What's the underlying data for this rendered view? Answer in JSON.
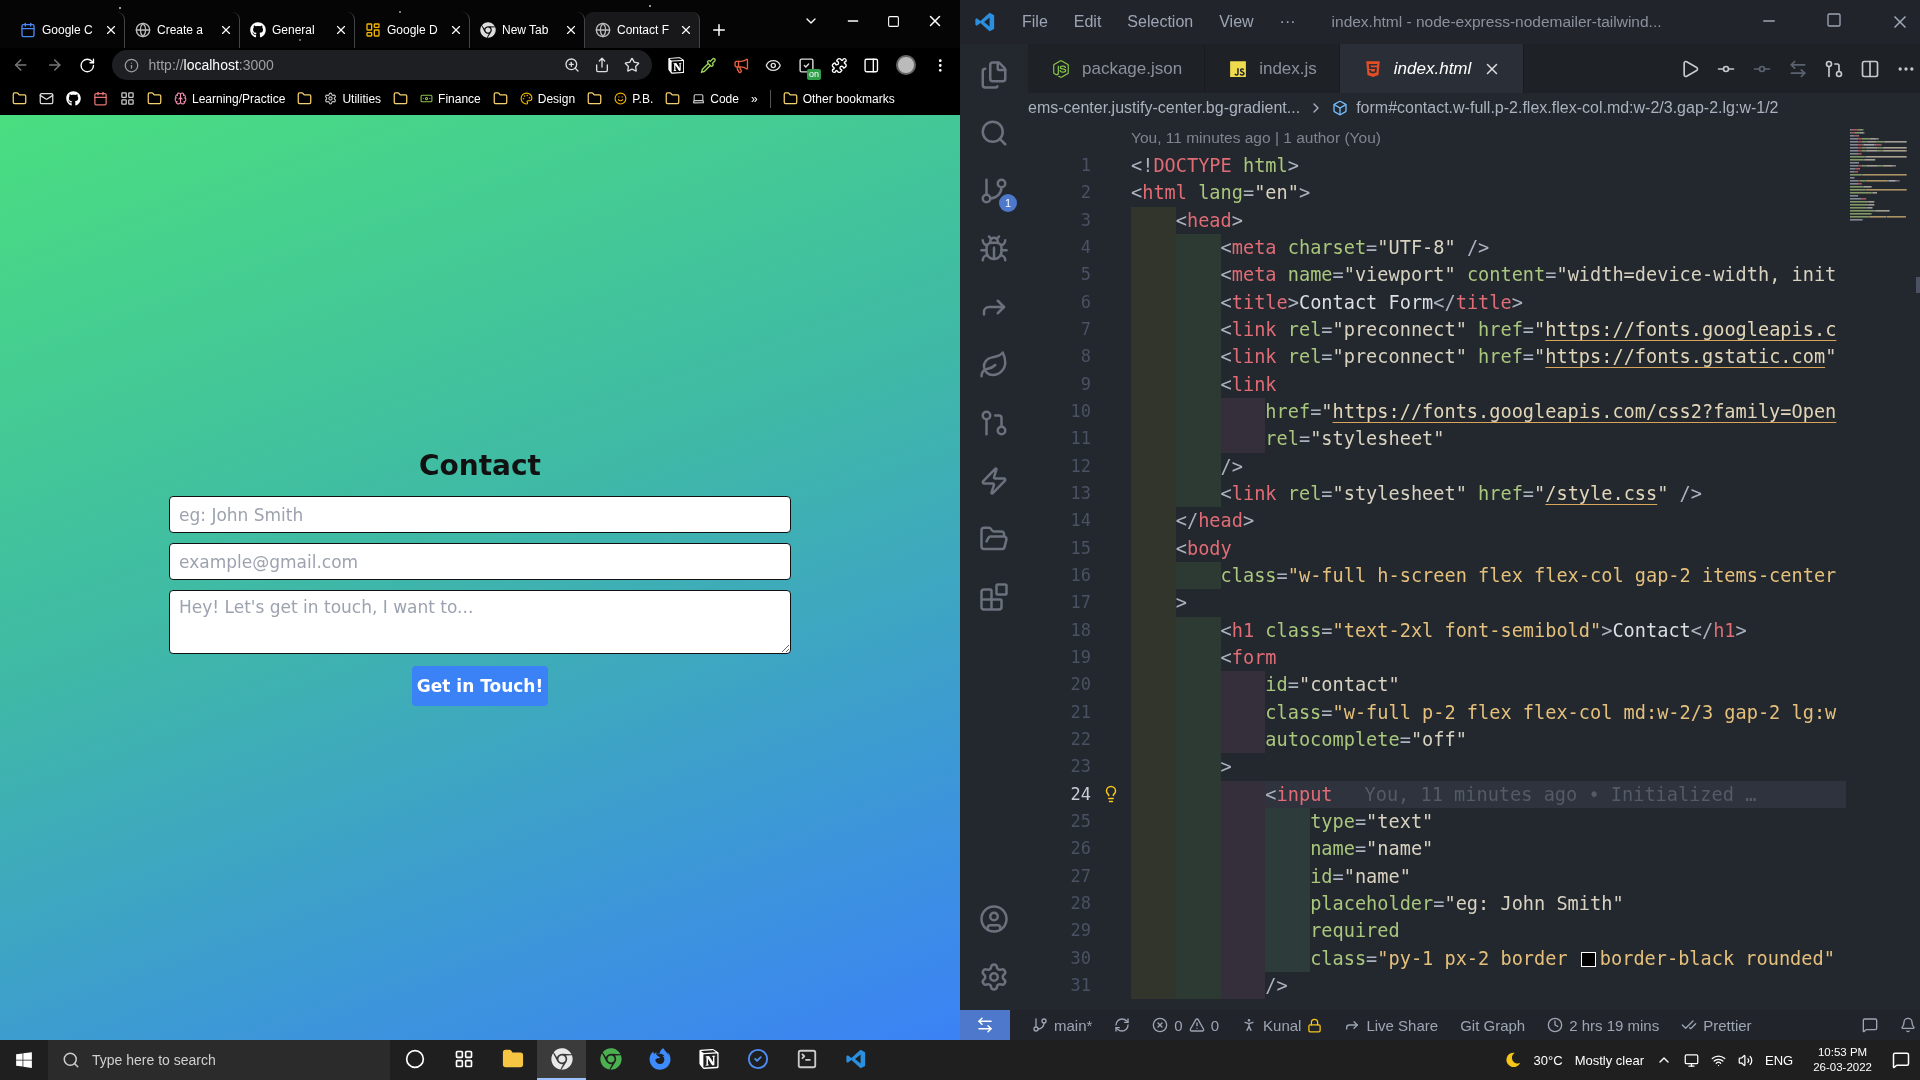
{
  "browser": {
    "tabs": [
      {
        "label": "Google C",
        "selected": false
      },
      {
        "label": "Create a",
        "selected": false
      },
      {
        "label": "General",
        "selected": false
      },
      {
        "label": "Google D",
        "selected": false
      },
      {
        "label": "New Tab",
        "selected": false
      },
      {
        "label": "Contact F",
        "selected": true
      }
    ],
    "url": "http://**localhost**:3000",
    "extension_badge": "on",
    "bookmarks": [
      "Learning/Practice",
      "Utilities",
      "Finance",
      "Design",
      "P.B.",
      "Code"
    ],
    "bookmarks_overflow": "»",
    "other_bookmarks": "Other bookmarks",
    "page": {
      "heading": "Contact",
      "fields": [
        {
          "kind": "input",
          "placeholder": "eg: John Smith"
        },
        {
          "kind": "input",
          "placeholder": "example@gmail.com"
        },
        {
          "kind": "textarea",
          "placeholder": "Hey! Let's get in touch, I want to..."
        }
      ],
      "button": "Get in Touch!"
    }
  },
  "editor": {
    "menu": [
      "File",
      "Edit",
      "Selection",
      "View",
      "···"
    ],
    "title": "index.html - node-express-nodemailer-tailwind...",
    "scm_badge": "1",
    "tabs": [
      {
        "label": "package.json",
        "selected": false
      },
      {
        "label": "index.js",
        "selected": false
      },
      {
        "label": "index.html",
        "selected": true
      }
    ],
    "breadcrumb": [
      "ems-center.justify-center.bg-gradient...",
      "form#contact.w-full.p-2.flex.flex-col.md:w-2/3.gap-2.lg:w-1/2"
    ],
    "codelens": "You, 11 minutes ago | 1 author (You)",
    "lines": [
      {
        "number": "1",
        "current": false,
        "tokens": [
          {
            "kind": "punct",
            "text": "<!"
          },
          {
            "kind": "tag",
            "text": "DOCTYPE"
          },
          {
            "kind": "attr",
            "text": " html"
          },
          {
            "kind": "punct",
            "text": ">"
          }
        ]
      },
      {
        "number": "2",
        "current": false,
        "tokens": [
          {
            "kind": "punct",
            "text": "<"
          },
          {
            "kind": "tag",
            "text": "html"
          },
          {
            "kind": "attr",
            "text": " lang"
          },
          {
            "kind": "punct",
            "text": "="
          },
          {
            "kind": "string",
            "text": "\"en\""
          },
          {
            "kind": "punct",
            "text": ">"
          }
        ]
      },
      {
        "number": "3",
        "current": false,
        "tokens": [
          {
            "kind": "punct",
            "text": "    <"
          },
          {
            "kind": "tag",
            "text": "head"
          },
          {
            "kind": "punct",
            "text": ">"
          }
        ]
      },
      {
        "number": "4",
        "current": false,
        "tokens": [
          {
            "kind": "punct",
            "text": "        <"
          },
          {
            "kind": "tag",
            "text": "meta"
          },
          {
            "kind": "attr",
            "text": " charset"
          },
          {
            "kind": "punct",
            "text": "="
          },
          {
            "kind": "string",
            "text": "\"UTF-8\""
          },
          {
            "kind": "punct",
            "text": " />"
          }
        ]
      },
      {
        "number": "5",
        "current": false,
        "tokens": [
          {
            "kind": "punct",
            "text": "        <"
          },
          {
            "kind": "tag",
            "text": "meta"
          },
          {
            "kind": "attr",
            "text": " name"
          },
          {
            "kind": "punct",
            "text": "="
          },
          {
            "kind": "string",
            "text": "\"viewport\""
          },
          {
            "kind": "attr",
            "text": " content"
          },
          {
            "kind": "punct",
            "text": "="
          },
          {
            "kind": "string",
            "text": "\"width=device-width, init"
          }
        ]
      },
      {
        "number": "6",
        "current": false,
        "tokens": [
          {
            "kind": "punct",
            "text": "        <"
          },
          {
            "kind": "tag",
            "text": "title"
          },
          {
            "kind": "punct",
            "text": ">"
          },
          {
            "kind": "text",
            "text": "Contact Form"
          },
          {
            "kind": "punct",
            "text": "</"
          },
          {
            "kind": "tag",
            "text": "title"
          },
          {
            "kind": "punct",
            "text": ">"
          }
        ]
      },
      {
        "number": "7",
        "current": false,
        "tokens": [
          {
            "kind": "punct",
            "text": "        <"
          },
          {
            "kind": "tag",
            "text": "link"
          },
          {
            "kind": "attr",
            "text": " rel"
          },
          {
            "kind": "punct",
            "text": "="
          },
          {
            "kind": "string",
            "text": "\"preconnect\""
          },
          {
            "kind": "attr",
            "text": " href"
          },
          {
            "kind": "punct",
            "text": "="
          },
          {
            "kind": "string",
            "text": "\""
          },
          {
            "kind": "link",
            "text": "https://fonts.googleapis.c"
          }
        ]
      },
      {
        "number": "8",
        "current": false,
        "tokens": [
          {
            "kind": "punct",
            "text": "        <"
          },
          {
            "kind": "tag",
            "text": "link"
          },
          {
            "kind": "attr",
            "text": " rel"
          },
          {
            "kind": "punct",
            "text": "="
          },
          {
            "kind": "string",
            "text": "\"preconnect\""
          },
          {
            "kind": "attr",
            "text": " href"
          },
          {
            "kind": "punct",
            "text": "="
          },
          {
            "kind": "string",
            "text": "\""
          },
          {
            "kind": "link",
            "text": "https://fonts.gstatic.com"
          },
          {
            "kind": "string",
            "text": "\""
          }
        ]
      },
      {
        "number": "9",
        "current": false,
        "tokens": [
          {
            "kind": "punct",
            "text": "        <"
          },
          {
            "kind": "tag",
            "text": "link"
          }
        ]
      },
      {
        "number": "10",
        "current": false,
        "tokens": [
          {
            "kind": "attr",
            "text": "            href"
          },
          {
            "kind": "punct",
            "text": "="
          },
          {
            "kind": "string",
            "text": "\""
          },
          {
            "kind": "link",
            "text": "https://fonts.googleapis.com/css2?family=Open"
          }
        ]
      },
      {
        "number": "11",
        "current": false,
        "tokens": [
          {
            "kind": "attr",
            "text": "            rel"
          },
          {
            "kind": "punct",
            "text": "="
          },
          {
            "kind": "string",
            "text": "\"stylesheet\""
          }
        ]
      },
      {
        "number": "12",
        "current": false,
        "tokens": [
          {
            "kind": "punct",
            "text": "        />"
          }
        ]
      },
      {
        "number": "13",
        "current": false,
        "tokens": [
          {
            "kind": "punct",
            "text": "        <"
          },
          {
            "kind": "tag",
            "text": "link"
          },
          {
            "kind": "attr",
            "text": " rel"
          },
          {
            "kind": "punct",
            "text": "="
          },
          {
            "kind": "string",
            "text": "\"stylesheet\""
          },
          {
            "kind": "attr",
            "text": " href"
          },
          {
            "kind": "punct",
            "text": "="
          },
          {
            "kind": "string",
            "text": "\""
          },
          {
            "kind": "link",
            "text": "/style.css"
          },
          {
            "kind": "string",
            "text": "\""
          },
          {
            "kind": "punct",
            "text": " />"
          }
        ]
      },
      {
        "number": "14",
        "current": false,
        "tokens": [
          {
            "kind": "punct",
            "text": "    </"
          },
          {
            "kind": "tag",
            "text": "head"
          },
          {
            "kind": "punct",
            "text": ">"
          }
        ]
      },
      {
        "number": "15",
        "current": false,
        "tokens": [
          {
            "kind": "punct",
            "text": "    <"
          },
          {
            "kind": "tag",
            "text": "body"
          }
        ]
      },
      {
        "number": "16",
        "current": false,
        "tokens": [
          {
            "kind": "attr",
            "text": "        class"
          },
          {
            "kind": "punct",
            "text": "="
          },
          {
            "kind": "classes",
            "text": "\"w-full h-screen flex flex-col gap-2 items-center"
          }
        ]
      },
      {
        "number": "17",
        "current": false,
        "tokens": [
          {
            "kind": "punct",
            "text": "    >"
          }
        ]
      },
      {
        "number": "18",
        "current": false,
        "tokens": [
          {
            "kind": "punct",
            "text": "        <"
          },
          {
            "kind": "tag",
            "text": "h1"
          },
          {
            "kind": "attr",
            "text": " class"
          },
          {
            "kind": "punct",
            "text": "="
          },
          {
            "kind": "classes",
            "text": "\"text-2xl font-semibold\""
          },
          {
            "kind": "punct",
            "text": ">"
          },
          {
            "kind": "text",
            "text": "Contact"
          },
          {
            "kind": "punct",
            "text": "</"
          },
          {
            "kind": "tag",
            "text": "h1"
          },
          {
            "kind": "punct",
            "text": ">"
          }
        ]
      },
      {
        "number": "19",
        "current": false,
        "tokens": [
          {
            "kind": "punct",
            "text": "        <"
          },
          {
            "kind": "tag",
            "text": "form"
          }
        ]
      },
      {
        "number": "20",
        "current": false,
        "tokens": [
          {
            "kind": "attr",
            "text": "            id"
          },
          {
            "kind": "punct",
            "text": "="
          },
          {
            "kind": "string",
            "text": "\"contact\""
          }
        ]
      },
      {
        "number": "21",
        "current": false,
        "tokens": [
          {
            "kind": "attr",
            "text": "            class"
          },
          {
            "kind": "punct",
            "text": "="
          },
          {
            "kind": "classes",
            "text": "\"w-full p-2 flex flex-col md:w-2/3 gap-2 lg:w"
          }
        ]
      },
      {
        "number": "22",
        "current": false,
        "tokens": [
          {
            "kind": "attr",
            "text": "            autocomplete"
          },
          {
            "kind": "punct",
            "text": "="
          },
          {
            "kind": "string",
            "text": "\"off\""
          }
        ]
      },
      {
        "number": "23",
        "current": false,
        "tokens": [
          {
            "kind": "punct",
            "text": "        >"
          }
        ]
      },
      {
        "number": "24",
        "current": true,
        "tokens": [
          {
            "kind": "punct",
            "text": "            <"
          },
          {
            "kind": "tag",
            "text": "input"
          }
        ],
        "blame": "You, 11 minutes ago • Initialized …"
      },
      {
        "number": "25",
        "current": false,
        "tokens": [
          {
            "kind": "attr",
            "text": "                type"
          },
          {
            "kind": "punct",
            "text": "="
          },
          {
            "kind": "string",
            "text": "\"text\""
          }
        ]
      },
      {
        "number": "26",
        "current": false,
        "tokens": [
          {
            "kind": "attr",
            "text": "                name"
          },
          {
            "kind": "punct",
            "text": "="
          },
          {
            "kind": "string",
            "text": "\"name\""
          }
        ]
      },
      {
        "number": "27",
        "current": false,
        "tokens": [
          {
            "kind": "attr",
            "text": "                id"
          },
          {
            "kind": "punct",
            "text": "="
          },
          {
            "kind": "string",
            "text": "\"name\""
          }
        ]
      },
      {
        "number": "28",
        "current": false,
        "tokens": [
          {
            "kind": "attr",
            "text": "                placeholder"
          },
          {
            "kind": "punct",
            "text": "="
          },
          {
            "kind": "string",
            "text": "\"eg: John Smith\""
          }
        ]
      },
      {
        "number": "29",
        "current": false,
        "tokens": [
          {
            "kind": "attr",
            "text": "                required"
          }
        ]
      },
      {
        "number": "30",
        "current": false,
        "tokens": [
          {
            "kind": "attr",
            "text": "                class"
          },
          {
            "kind": "punct",
            "text": "="
          },
          {
            "kind": "classes",
            "text": "\"py-1 px-2 border "
          },
          {
            "kind": "swatch",
            "color": "#000000"
          },
          {
            "kind": "classes",
            "text": "border-black rounded\""
          }
        ]
      },
      {
        "number": "31",
        "current": false,
        "tokens": [
          {
            "kind": "punct",
            "text": "            />"
          }
        ]
      }
    ],
    "status": {
      "branch": "main*",
      "errors": "0",
      "warnings": "0",
      "user": "Kunal",
      "live_share": "Live Share",
      "git_graph": "Git Graph",
      "timer": "2 hrs 19 mins",
      "formatter": "Prettier"
    }
  },
  "taskbar": {
    "search_placeholder": "Type here to search",
    "apps": [
      {
        "active": false
      },
      {
        "active": false
      },
      {
        "active": false
      },
      {
        "active": true
      },
      {
        "active": false
      },
      {
        "active": false
      },
      {
        "active": false
      },
      {
        "active": false
      },
      {
        "active": false
      },
      {
        "active": false
      }
    ],
    "temperature": "30°C",
    "weather": "Mostly clear",
    "language": "ENG",
    "time": "10:53 PM",
    "date": "26-03-2022"
  }
}
